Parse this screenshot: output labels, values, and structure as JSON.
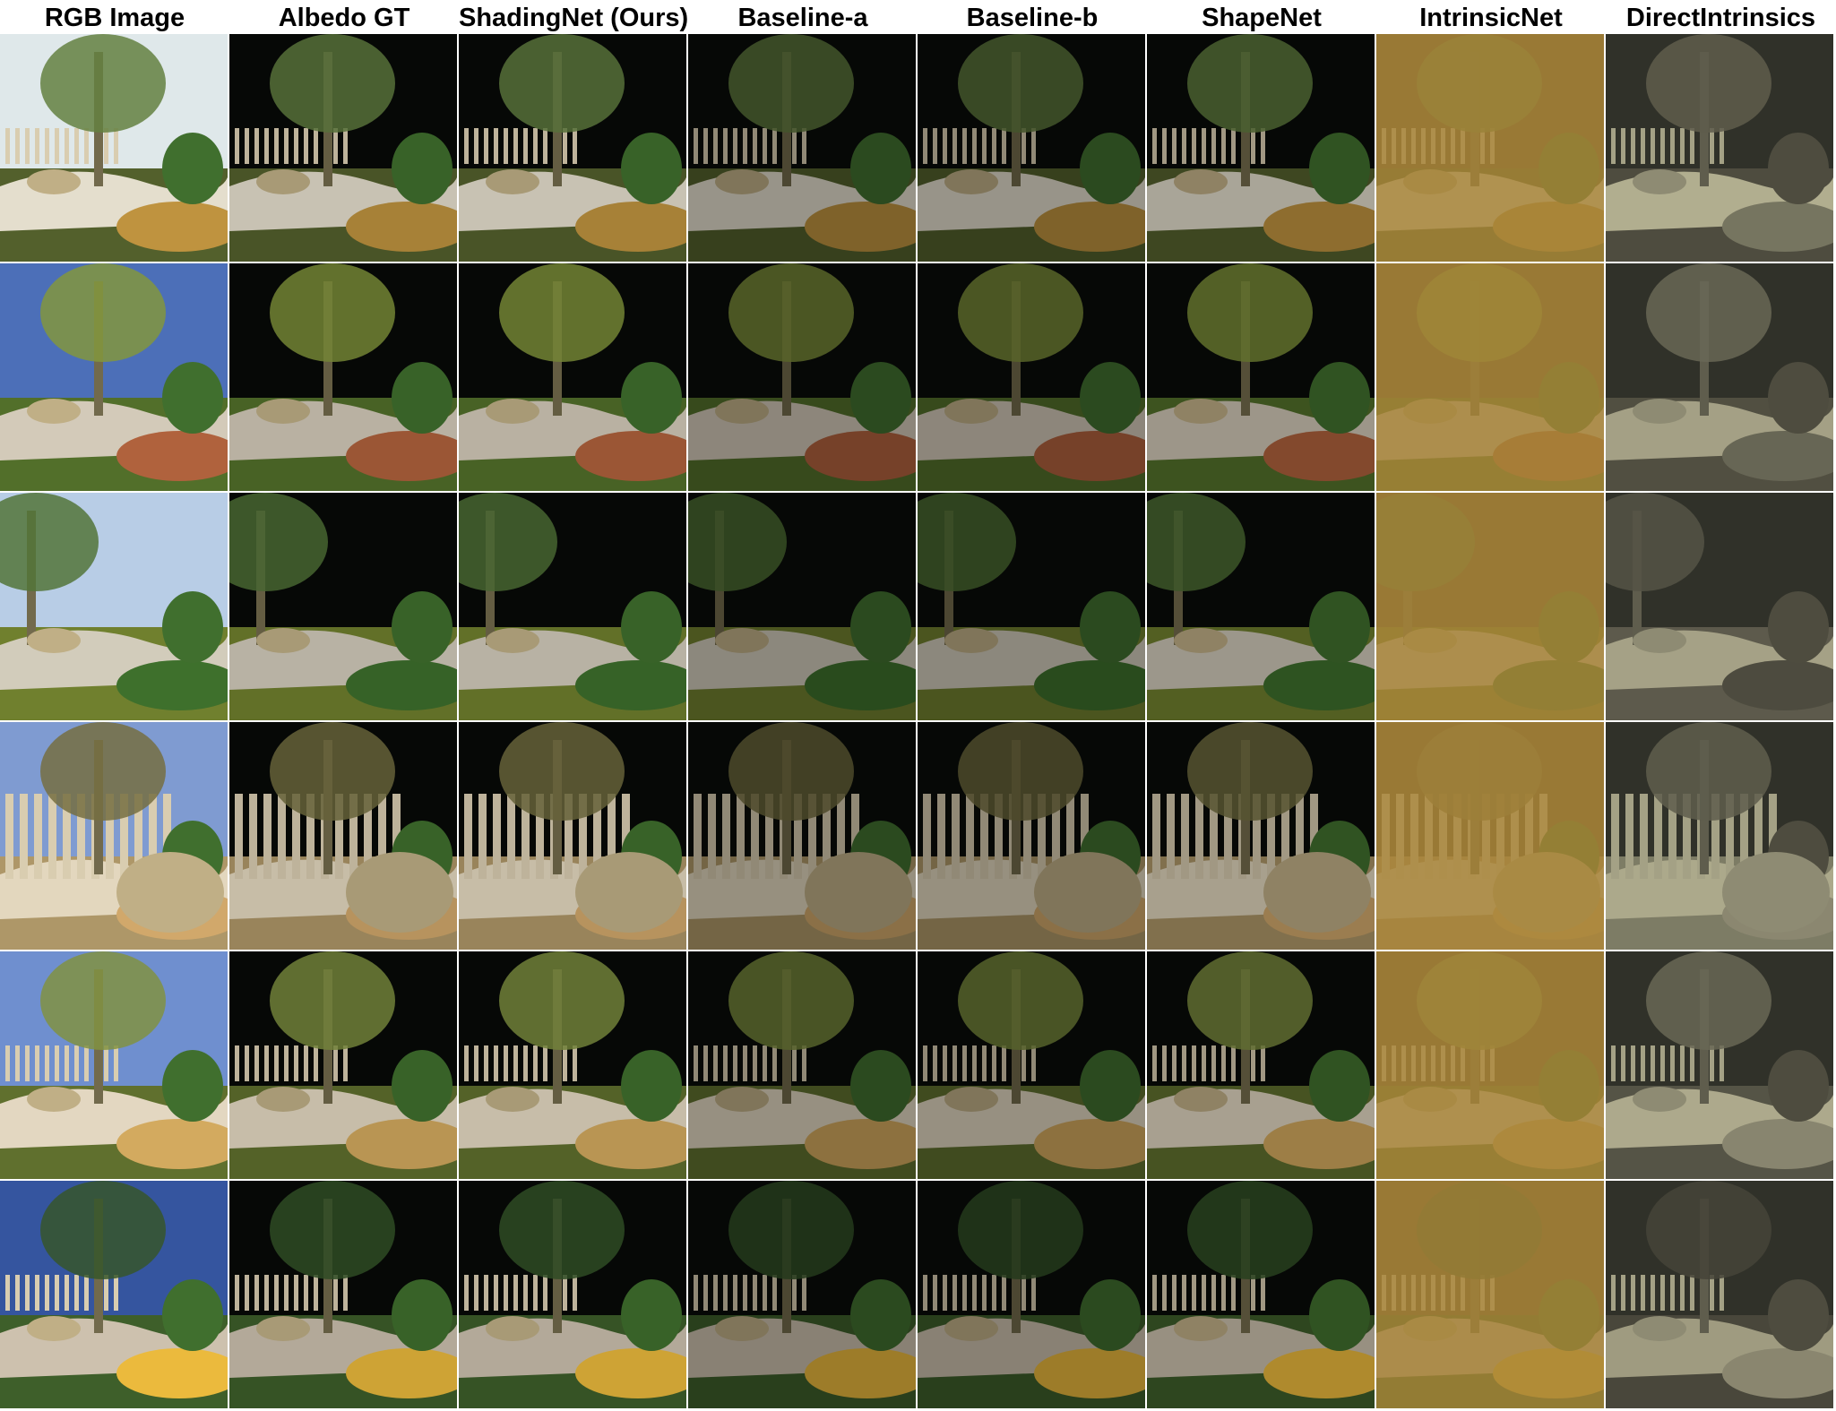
{
  "figure": {
    "columns": [
      "RGB Image",
      "Albedo GT",
      "ShadingNet (Ours)",
      "Baseline-a",
      "Baseline-b",
      "ShapeNet",
      "IntrinsicNet",
      "DirectIntrinsics"
    ],
    "rows": [
      {
        "scene": "tree-fence-path-bushes"
      },
      {
        "scene": "trees-rocks-bush-gravel"
      },
      {
        "scene": "tree-hill-bush"
      },
      {
        "scene": "tree-fence-boulder"
      },
      {
        "scene": "tree-fence-rocks-path"
      },
      {
        "scene": "fence-shrubs-flowers"
      }
    ]
  }
}
